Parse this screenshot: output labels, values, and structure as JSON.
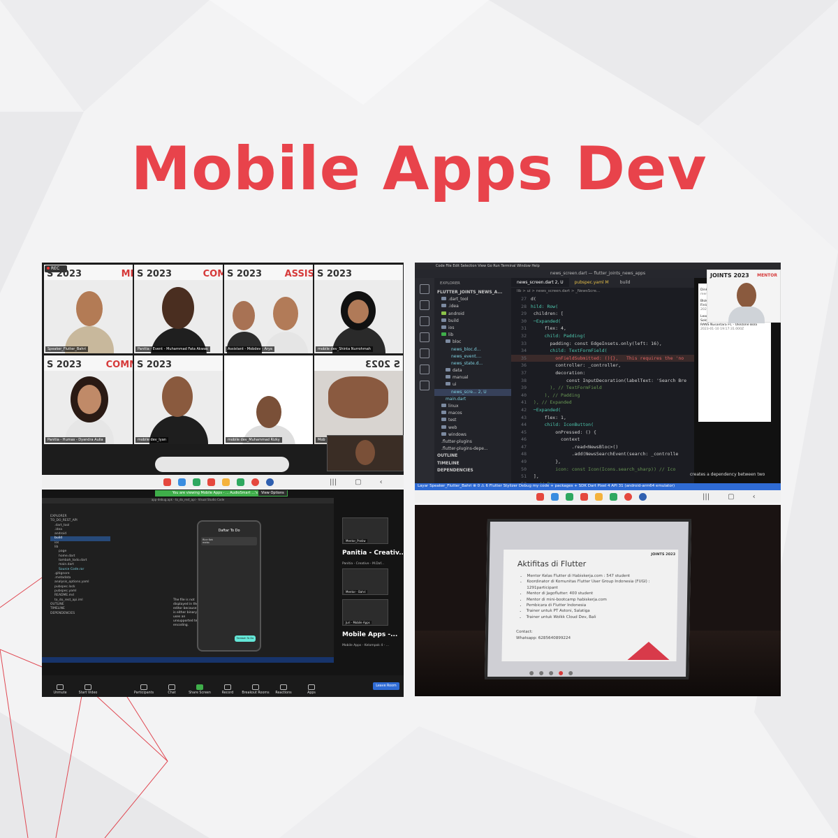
{
  "title": "Mobile Apps Dev",
  "colors": {
    "accent": "#e8434b",
    "background": "#f3f3f4",
    "vscode_status": "#2f6bd4",
    "zoom_share_green": "#3fae4a"
  },
  "gallery": {
    "rec_label": "REC",
    "tiles": [
      {
        "banner_a": "S 2023",
        "banner_b": "ME",
        "name": "Speaker_Flutter_Bahri"
      },
      {
        "banner_a": "S 2023",
        "banner_b": "COMM",
        "name": "Panitia - Event - Muhammad Fata Akwas"
      },
      {
        "banner_a": "S 2023",
        "banner_b": "ASSIS",
        "name": "Assistant - Mobdev - Arya"
      },
      {
        "banner_a": "S 2023",
        "banner_b": "",
        "name": "mobile dev_Shinta Nurrohmah"
      },
      {
        "banner_a": "S 2023",
        "banner_b": "COMM",
        "name": "Panitia - Humas - Dyandra Aulia"
      },
      {
        "banner_a": "S 2023",
        "banner_b": "",
        "name": "mobile dev_Iyan"
      },
      {
        "banner_a": "",
        "banner_b": "",
        "name": "mobile dev_Muhammad Rizky"
      },
      {
        "banner_a": "S 2023",
        "banner_b": "",
        "name": "Mob"
      }
    ]
  },
  "vscode": {
    "menu": "Code   File   Edit   Selection   View   Go   Run   Terminal   Window   Help",
    "window_title": "news_screen.dart — flutter_joints_news_apps",
    "explorer_header": "EXPLORER",
    "project": "FLUTTER_JOINTS_NEWS_A...",
    "tree": [
      ".dart_tool",
      ".idea",
      "android",
      "build",
      "ios",
      "lib",
      "bloc",
      "news_bloc.d...",
      "news_event....",
      "news_state.d...",
      "data",
      "manual",
      "ui",
      "news_scre... 2, U",
      "main.dart",
      "linux",
      "macos",
      "test",
      "web",
      "windows",
      ".flutter-plugins",
      ".flutter-plugins-depe...",
      "OUTLINE",
      "TIMELINE",
      "DEPENDENCIES"
    ],
    "tabs": [
      "news_screen.dart 2, U",
      "pubspec.yaml M",
      "build"
    ],
    "breadcrumb": "lib > ui > news_screen.dart > _NewsScre...",
    "lines": [
      {
        "n": "27",
        "code": "d("
      },
      {
        "n": "28",
        "code": "hild: Row("
      },
      {
        "n": "29",
        "code": " children: ["
      },
      {
        "n": "30",
        "code": " ─Expanded("
      },
      {
        "n": "31",
        "code": "     flex: 4,"
      },
      {
        "n": "32",
        "code": "     child: Padding("
      },
      {
        "n": "33",
        "code": "       padding: const EdgeInsets.only(left: 16),"
      },
      {
        "n": "34",
        "code": "       child: TextFormField("
      },
      {
        "n": "35",
        "code": "         onFieldSubmitted: (){},   This requires the 'no"
      },
      {
        "n": "36",
        "code": "         controller: _controller,"
      },
      {
        "n": "37",
        "code": "         decoration:"
      },
      {
        "n": "38",
        "code": "             const InputDecoration(labelText: 'Search Bre"
      },
      {
        "n": "39",
        "code": "       ), // TextFormField"
      },
      {
        "n": "40",
        "code": "     ), // Padding"
      },
      {
        "n": "41",
        "code": " ), // Expanded"
      },
      {
        "n": "42",
        "code": " ─Expanded("
      },
      {
        "n": "43",
        "code": "     flex: 1,"
      },
      {
        "n": "44",
        "code": "     child: IconButton("
      },
      {
        "n": "45",
        "code": "         onPressed: () {"
      },
      {
        "n": "46",
        "code": "           context"
      },
      {
        "n": "47",
        "code": "               .read<NewsBloc>()"
      },
      {
        "n": "48",
        "code": "               .add(NewsSearchEvent(search: _controlle"
      },
      {
        "n": "49",
        "code": "         },"
      },
      {
        "n": "50",
        "code": "         icon: const Icon(Icons.search_sharp)) // Ico"
      },
      {
        "n": "51",
        "code": " ],"
      },
      {
        "n": "52",
        "code": " , // Row"
      },
      {
        "n": "53",
        "code": " // Card"
      },
      {
        "n": "54",
        "code": " cConsumer("
      },
      {
        "n": "55",
        "code": " uilder: (context, state) {"
      },
      {
        "n": "56",
        "code": "  if (state is NewsLoadingState) {"
      }
    ],
    "status": "Layar Speaker_Flutter_Bahri    ⊗ 0 ⚠ 6    Flutter Stylizer    Debug my code + packages + SDK    Dart    Pixel 4 API 31 (android-arm64 emulator)",
    "hint": "creates a dependency between two",
    "news": [
      {
        "text": "Dinkes",
        "date": "merebaknya campak rubela - ANTARA"
      },
      {
        "text": "Blokade Turki Atas Keanggotaan Swedia-Finlandia Bikin NATO Frustrasi - detikNews",
        "date": "2023-01-31 02:08:05.000Z"
      },
      {
        "text": "Leonardo Medina Ungkap Penyebab Persis Solo Comeback dan Menang 3-2 atas RANS Nusantara FC - Okezone Bola",
        "date": "2023-01-10 19:17:31.000Z"
      }
    ],
    "cam_label": "JOINTS 2023",
    "cam_role": "MENTOR"
  },
  "share": {
    "viewing": "You are viewing Mobile Apps - ... AudioSmart ...'s screen",
    "view_options": "View Options",
    "window_title": "app-debug.apk - to_do_rest_api - Visual Studio Code",
    "explorer": [
      "EXPLORER",
      "TO_DO_REST_API",
      ".dart_tool",
      ".idea",
      "android",
      "build",
      "ios",
      "lib",
      "page",
      "home.dart",
      "tambah_todo.dart",
      "main.dart",
      "Source Code.rar",
      ".gitignore",
      ".metadata",
      "analysis_options.yaml",
      "pubspec.lock",
      "pubspec.yaml",
      "README.md",
      "to_do_rest_api.iml",
      "OUTLINE",
      "TIMELINE",
      "DEPENDENCIES"
    ],
    "phone_title": "Daftar To Do",
    "phone_card_a": "Rice Kek",
    "phone_card_b": "meko",
    "phone_button": "Tambah To Do",
    "not_found": "The file is not displayed in the editor because it is either binary or uses an unsupported text encoding.",
    "right": {
      "thumb1": "Mentor_Pratiw",
      "big1": "Panitia - Creativ...",
      "thumb_caption": "Panitia - Creative - M.Daf...",
      "thumb2": "Mentor - Bahri",
      "thumb3": "Juri - Mobile Apps",
      "big2": "Mobile Apps -...",
      "caption2": "Mobile Apps - Kelompok 4 - ..."
    },
    "toolbar": [
      "Unmute",
      "Start Video",
      "Participants",
      "Chat",
      "Share Screen",
      "Record",
      "Breakout Rooms",
      "Reactions",
      "Apps"
    ],
    "participants_count": "9",
    "leave": "Leave Room"
  },
  "slide": {
    "title": "Aktifitas di Flutter",
    "bullets": [
      "Mentor Kelas Flutter di Habiskerja.com : 547 student",
      "Koordinator di Komunitas Flutter User Group Indonesia (FUGI) : 1291participant",
      "Mentor di Jagoflutter: 400 student",
      "Mentor di mini-bootcamp habiskerja.com",
      "Pembicara di Flutter Indonesia",
      "Trainer untuk PT Astoni, Salatiga",
      "Trainer untuk Wolkk Cloud Dev, Bali"
    ],
    "contact_label": "Contact:",
    "whatsapp": "Whatsapp: 6285640899224",
    "joints": "JOINTS 2023"
  }
}
